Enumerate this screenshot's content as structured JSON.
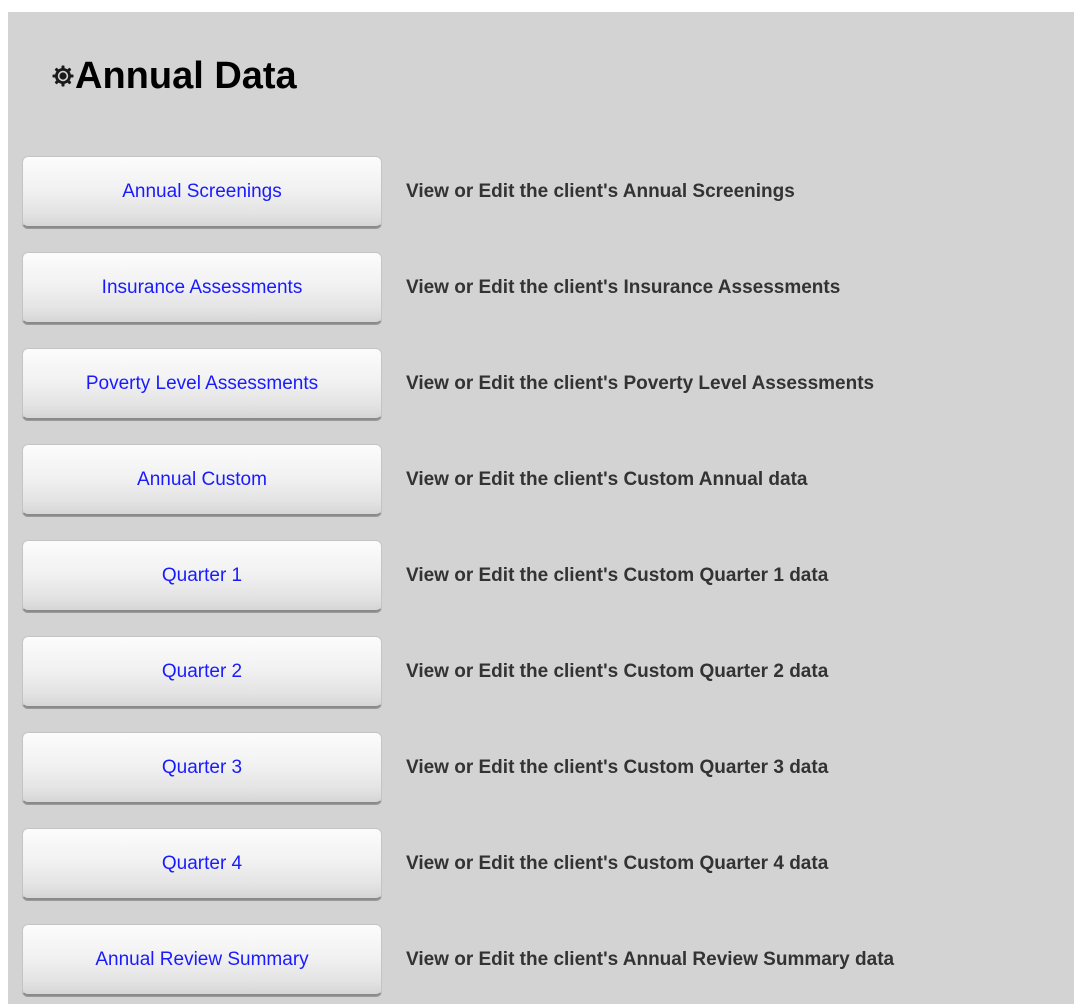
{
  "header": {
    "title": "Annual Data",
    "icon": "gear-icon"
  },
  "colors": {
    "panel_bg": "#d3d3d3",
    "button_text": "#1a1aff",
    "description_text": "#333333"
  },
  "items": [
    {
      "button": "Annual Screenings",
      "description": "View or Edit the client's Annual Screenings"
    },
    {
      "button": "Insurance Assessments",
      "description": "View or Edit the client's Insurance Assessments"
    },
    {
      "button": "Poverty Level Assessments",
      "description": "View or Edit the client's Poverty Level Assessments"
    },
    {
      "button": "Annual Custom",
      "description": "View or Edit the client's Custom Annual data"
    },
    {
      "button": "Quarter 1",
      "description": "View or Edit the client's Custom Quarter 1 data"
    },
    {
      "button": "Quarter 2",
      "description": "View or Edit the client's Custom Quarter 2 data"
    },
    {
      "button": "Quarter 3",
      "description": "View or Edit the client's Custom Quarter 3 data"
    },
    {
      "button": "Quarter 4",
      "description": "View or Edit the client's Custom Quarter 4 data"
    },
    {
      "button": "Annual Review Summary",
      "description": "View or Edit the client's Annual Review Summary data"
    }
  ]
}
